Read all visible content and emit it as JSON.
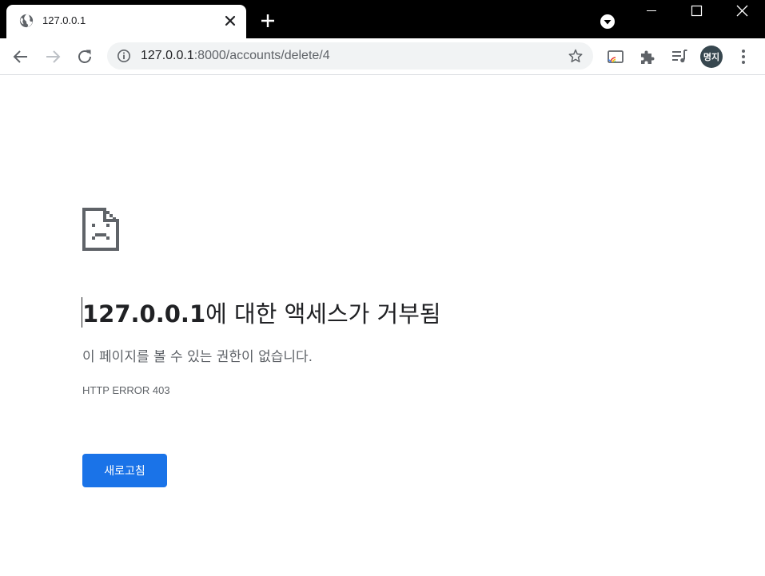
{
  "tab": {
    "title": "127.0.0.1"
  },
  "omnibox": {
    "host": "127.0.0.1",
    "path": ":8000/accounts/delete/4"
  },
  "profile": {
    "initials": "명지"
  },
  "error": {
    "host": "127.0.0.1",
    "heading_suffix": "에 대한 액세스가 거부됨",
    "message": "이 페이지를 볼 수 있는 권한이 없습니다.",
    "code": "HTTP ERROR 403",
    "reload_label": "새로고침"
  },
  "icons": {
    "tab_favicon": "globe-icon",
    "tab_close": "close-icon",
    "new_tab": "plus-icon",
    "tab_search": "chevron-down-circle-icon",
    "back": "arrow-left-icon",
    "forward": "arrow-right-icon",
    "reload": "refresh-icon",
    "site_info": "info-icon",
    "bookmark": "star-icon",
    "cast": "cast-icon",
    "extensions": "puzzle-icon",
    "media": "playlist-icon",
    "menu": "kebab-menu-icon",
    "error": "sad-document-icon"
  },
  "colors": {
    "accent": "#1a73e8",
    "frame": "#000000",
    "omnibox_bg": "#f1f3f4"
  }
}
